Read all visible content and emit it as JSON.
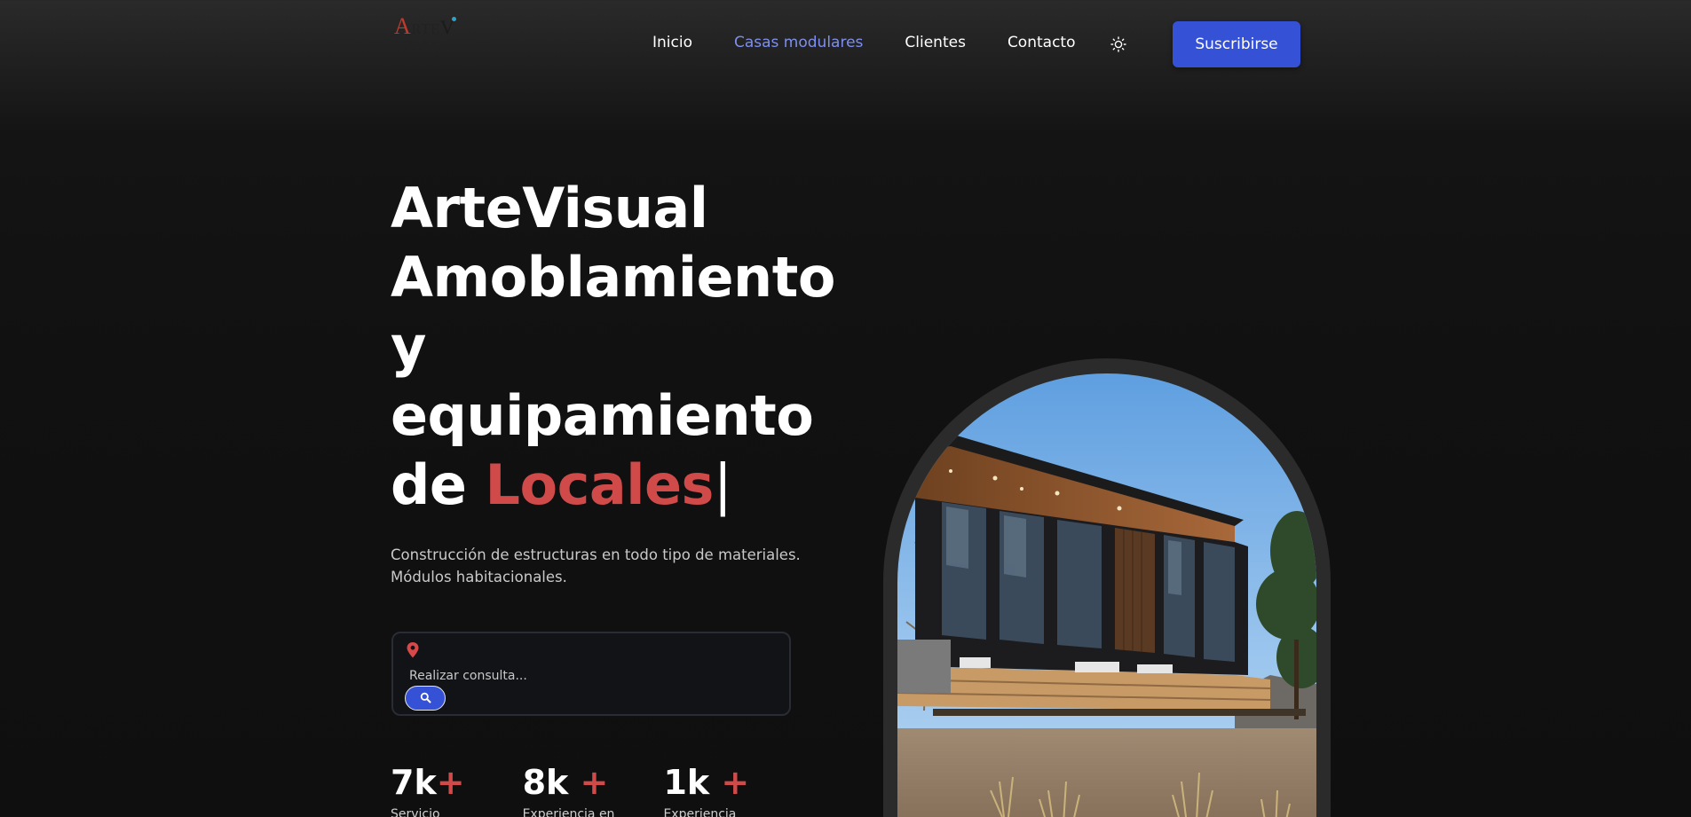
{
  "brand": {
    "logo_text_initial": "A",
    "logo_text_mid": "RTE",
    "logo_text_v": "V",
    "logo_text_rest": "ISUAL"
  },
  "nav": {
    "items": [
      {
        "label": "Inicio",
        "active": false
      },
      {
        "label": "Casas modulares",
        "active": true
      },
      {
        "label": "Clientes",
        "active": false
      },
      {
        "label": "Contacto",
        "active": false
      }
    ],
    "theme_toggle_icon": "sun-icon",
    "subscribe_label": "Suscribirse"
  },
  "hero": {
    "title_line1": "ArteVisual",
    "title_line2": "Amoblamiento",
    "title_line3": "y",
    "title_line4": "equipamiento",
    "title_prefix": "de ",
    "title_highlight": "Locales",
    "title_cursor": "|",
    "subtitle_line1": "Construcción de estructuras en todo tipo de materiales.",
    "subtitle_line2": "Módulos habitacionales."
  },
  "search": {
    "placeholder": "Realizar consulta...",
    "value": "",
    "location_icon": "map-pin-icon",
    "button_icon": "search-icon"
  },
  "stats": [
    {
      "value": "7k",
      "plus": "+",
      "label": "Servicio"
    },
    {
      "value": "8k ",
      "plus": "+",
      "label": "Experiencia en"
    },
    {
      "value": "1k ",
      "plus": "+",
      "label": "Experiencia"
    }
  ],
  "colors": {
    "accent_blue": "#3551d6",
    "active_nav": "#7d8ff0",
    "highlight_red": "#d14a4a",
    "background": "#111111"
  }
}
